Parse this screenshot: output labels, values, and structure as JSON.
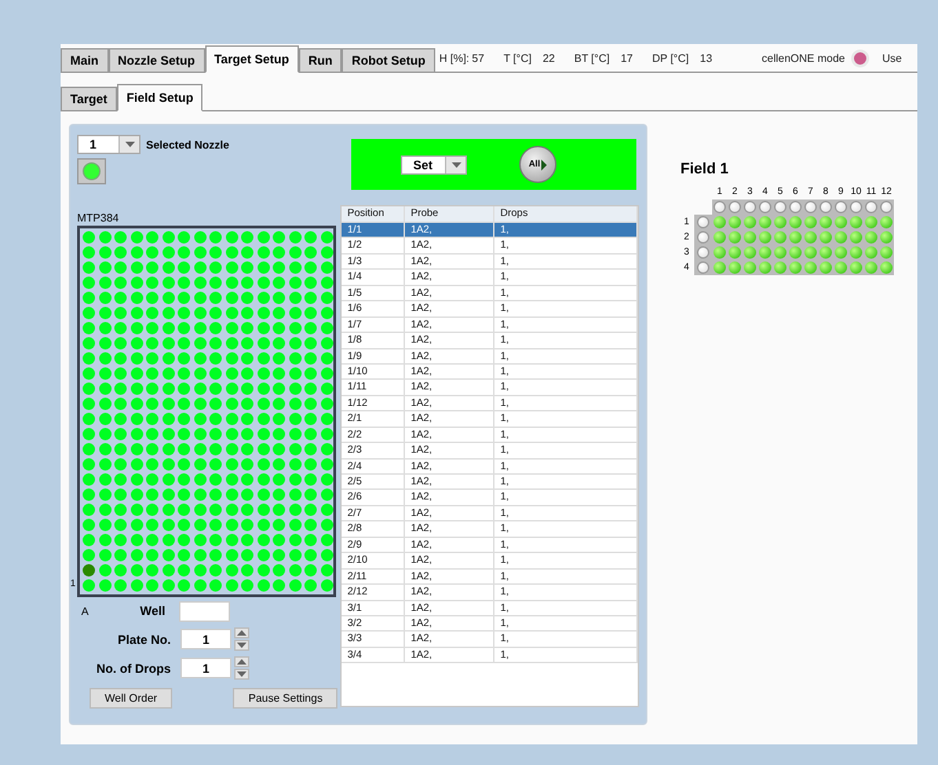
{
  "tabs": [
    {
      "label": "Main",
      "selected": false
    },
    {
      "label": "Nozzle Setup",
      "selected": false
    },
    {
      "label": "Target Setup",
      "selected": true
    },
    {
      "label": "Run",
      "selected": false
    },
    {
      "label": "Robot Setup",
      "selected": false
    }
  ],
  "readings": [
    {
      "label": "H [%]:",
      "value": "57"
    },
    {
      "label": "T [°C]",
      "value": "22"
    },
    {
      "label": "BT [°C]",
      "value": "17"
    },
    {
      "label": "DP [°C]",
      "value": "13"
    }
  ],
  "mode": {
    "label": "cellenONE mode",
    "color": "#cc5c8c"
  },
  "user_fragment": "Use",
  "subtabs": [
    {
      "label": "Target",
      "selected": false
    },
    {
      "label": "Field Setup",
      "selected": true
    }
  ],
  "nozzle": {
    "value": "1",
    "label": "Selected Nozzle",
    "led_on": true
  },
  "set_bar": {
    "mode": "Set",
    "all_button": "All"
  },
  "plate": {
    "title": "MTP384",
    "row_label": "1",
    "column_label": "A",
    "wells": [
      [
        false,
        false,
        false,
        false,
        false,
        false,
        false,
        false,
        false,
        false,
        false,
        false,
        false,
        false,
        false,
        false
      ],
      [
        false,
        false,
        false,
        false,
        false,
        false,
        false,
        false,
        false,
        false,
        false,
        false,
        false,
        false,
        false,
        false
      ],
      [
        false,
        false,
        false,
        false,
        false,
        false,
        false,
        false,
        false,
        false,
        false,
        false,
        false,
        false,
        false,
        false
      ],
      [
        false,
        false,
        false,
        false,
        false,
        false,
        false,
        false,
        false,
        false,
        false,
        false,
        false,
        false,
        false,
        false
      ],
      [
        false,
        false,
        false,
        false,
        false,
        false,
        false,
        false,
        false,
        false,
        false,
        false,
        false,
        false,
        false,
        false
      ],
      [
        false,
        false,
        false,
        false,
        false,
        false,
        false,
        false,
        false,
        false,
        false,
        false,
        false,
        false,
        false,
        false
      ],
      [
        false,
        false,
        false,
        false,
        false,
        false,
        false,
        false,
        false,
        false,
        false,
        false,
        false,
        false,
        false,
        false
      ],
      [
        false,
        false,
        false,
        false,
        false,
        false,
        false,
        false,
        false,
        false,
        false,
        false,
        false,
        false,
        false,
        false
      ],
      [
        false,
        false,
        false,
        false,
        false,
        false,
        false,
        false,
        false,
        false,
        false,
        false,
        false,
        false,
        false,
        false
      ],
      [
        false,
        false,
        false,
        false,
        false,
        false,
        false,
        false,
        false,
        false,
        false,
        false,
        false,
        false,
        false,
        false
      ],
      [
        false,
        false,
        false,
        false,
        false,
        false,
        false,
        false,
        false,
        false,
        false,
        false,
        false,
        false,
        false,
        false
      ],
      [
        false,
        false,
        false,
        false,
        false,
        false,
        false,
        false,
        false,
        false,
        false,
        false,
        false,
        false,
        false,
        false
      ],
      [
        false,
        false,
        false,
        false,
        false,
        false,
        false,
        false,
        false,
        false,
        false,
        false,
        false,
        false,
        false,
        false
      ],
      [
        false,
        false,
        false,
        false,
        false,
        false,
        false,
        false,
        false,
        false,
        false,
        false,
        false,
        false,
        false,
        false
      ],
      [
        false,
        false,
        false,
        false,
        false,
        false,
        false,
        false,
        false,
        false,
        false,
        false,
        false,
        false,
        false,
        false
      ],
      [
        false,
        false,
        false,
        false,
        false,
        false,
        false,
        false,
        false,
        false,
        false,
        false,
        false,
        false,
        false,
        false
      ],
      [
        false,
        false,
        false,
        false,
        false,
        false,
        false,
        false,
        false,
        false,
        false,
        false,
        false,
        false,
        false,
        false
      ],
      [
        false,
        false,
        false,
        false,
        false,
        false,
        false,
        false,
        false,
        false,
        false,
        false,
        false,
        false,
        false,
        false
      ],
      [
        false,
        false,
        false,
        false,
        false,
        false,
        false,
        false,
        false,
        false,
        false,
        false,
        false,
        false,
        false,
        false
      ],
      [
        false,
        false,
        false,
        false,
        false,
        false,
        false,
        false,
        false,
        false,
        false,
        false,
        false,
        false,
        false,
        false
      ],
      [
        false,
        false,
        false,
        false,
        false,
        false,
        false,
        false,
        false,
        false,
        false,
        false,
        false,
        false,
        false,
        false
      ],
      [
        false,
        false,
        false,
        false,
        false,
        false,
        false,
        false,
        false,
        false,
        false,
        false,
        false,
        false,
        false,
        false
      ],
      [
        true,
        false,
        false,
        false,
        false,
        false,
        false,
        false,
        false,
        false,
        false,
        false,
        false,
        false,
        false,
        false
      ],
      [
        false,
        false,
        false,
        false,
        false,
        false,
        false,
        false,
        false,
        false,
        false,
        false,
        false,
        false,
        false,
        false
      ]
    ]
  },
  "well_field": {
    "label": "Well"
  },
  "plate_no": {
    "label": "Plate No.",
    "value": "1"
  },
  "drops": {
    "label": "No. of Drops",
    "value": "1"
  },
  "buttons": [
    "Well Order",
    "Pause Settings"
  ],
  "table": {
    "columns": [
      "Position",
      "Probe",
      "Drops"
    ],
    "rows": [
      {
        "cells": [
          "1/1",
          "1A2,",
          "1,"
        ],
        "selected": true
      },
      {
        "cells": [
          "1/2",
          "1A2,",
          "1,"
        ],
        "selected": false
      },
      {
        "cells": [
          "1/3",
          "1A2,",
          "1,"
        ],
        "selected": false
      },
      {
        "cells": [
          "1/4",
          "1A2,",
          "1,"
        ],
        "selected": false
      },
      {
        "cells": [
          "1/5",
          "1A2,",
          "1,"
        ],
        "selected": false
      },
      {
        "cells": [
          "1/6",
          "1A2,",
          "1,"
        ],
        "selected": false
      },
      {
        "cells": [
          "1/7",
          "1A2,",
          "1,"
        ],
        "selected": false
      },
      {
        "cells": [
          "1/8",
          "1A2,",
          "1,"
        ],
        "selected": false
      },
      {
        "cells": [
          "1/9",
          "1A2,",
          "1,"
        ],
        "selected": false
      },
      {
        "cells": [
          "1/10",
          "1A2,",
          "1,"
        ],
        "selected": false
      },
      {
        "cells": [
          "1/11",
          "1A2,",
          "1,"
        ],
        "selected": false
      },
      {
        "cells": [
          "1/12",
          "1A2,",
          "1,"
        ],
        "selected": false
      },
      {
        "cells": [
          "2/1",
          "1A2,",
          "1,"
        ],
        "selected": false
      },
      {
        "cells": [
          "2/2",
          "1A2,",
          "1,"
        ],
        "selected": false
      },
      {
        "cells": [
          "2/3",
          "1A2,",
          "1,"
        ],
        "selected": false
      },
      {
        "cells": [
          "2/4",
          "1A2,",
          "1,"
        ],
        "selected": false
      },
      {
        "cells": [
          "2/5",
          "1A2,",
          "1,"
        ],
        "selected": false
      },
      {
        "cells": [
          "2/6",
          "1A2,",
          "1,"
        ],
        "selected": false
      },
      {
        "cells": [
          "2/7",
          "1A2,",
          "1,"
        ],
        "selected": false
      },
      {
        "cells": [
          "2/8",
          "1A2,",
          "1,"
        ],
        "selected": false
      },
      {
        "cells": [
          "2/9",
          "1A2,",
          "1,"
        ],
        "selected": false
      },
      {
        "cells": [
          "2/10",
          "1A2,",
          "1,"
        ],
        "selected": false
      },
      {
        "cells": [
          "2/11",
          "1A2,",
          "1,"
        ],
        "selected": false
      },
      {
        "cells": [
          "2/12",
          "1A2,",
          "1,"
        ],
        "selected": false
      },
      {
        "cells": [
          "3/1",
          "1A2,",
          "1,"
        ],
        "selected": false
      },
      {
        "cells": [
          "3/2",
          "1A2,",
          "1,"
        ],
        "selected": false
      },
      {
        "cells": [
          "3/3",
          "1A2,",
          "1,"
        ],
        "selected": false
      },
      {
        "cells": [
          "3/4",
          "1A2,",
          "1,"
        ],
        "selected": false
      }
    ]
  },
  "field": {
    "title": "Field 1",
    "columns": [
      "1",
      "2",
      "3",
      "4",
      "5",
      "6",
      "7",
      "8",
      "9",
      "10",
      "11",
      "12"
    ],
    "rows": [
      "1",
      "2",
      "3",
      "4"
    ],
    "wells": [
      [
        true,
        true,
        true,
        true,
        true,
        true,
        true,
        true,
        true,
        true,
        true,
        true
      ],
      [
        true,
        true,
        true,
        true,
        true,
        true,
        true,
        true,
        true,
        true,
        true,
        true
      ],
      [
        true,
        true,
        true,
        true,
        true,
        true,
        true,
        true,
        true,
        true,
        true,
        true
      ],
      [
        true,
        true,
        true,
        true,
        true,
        true,
        true,
        true,
        true,
        true,
        true,
        true
      ]
    ]
  }
}
